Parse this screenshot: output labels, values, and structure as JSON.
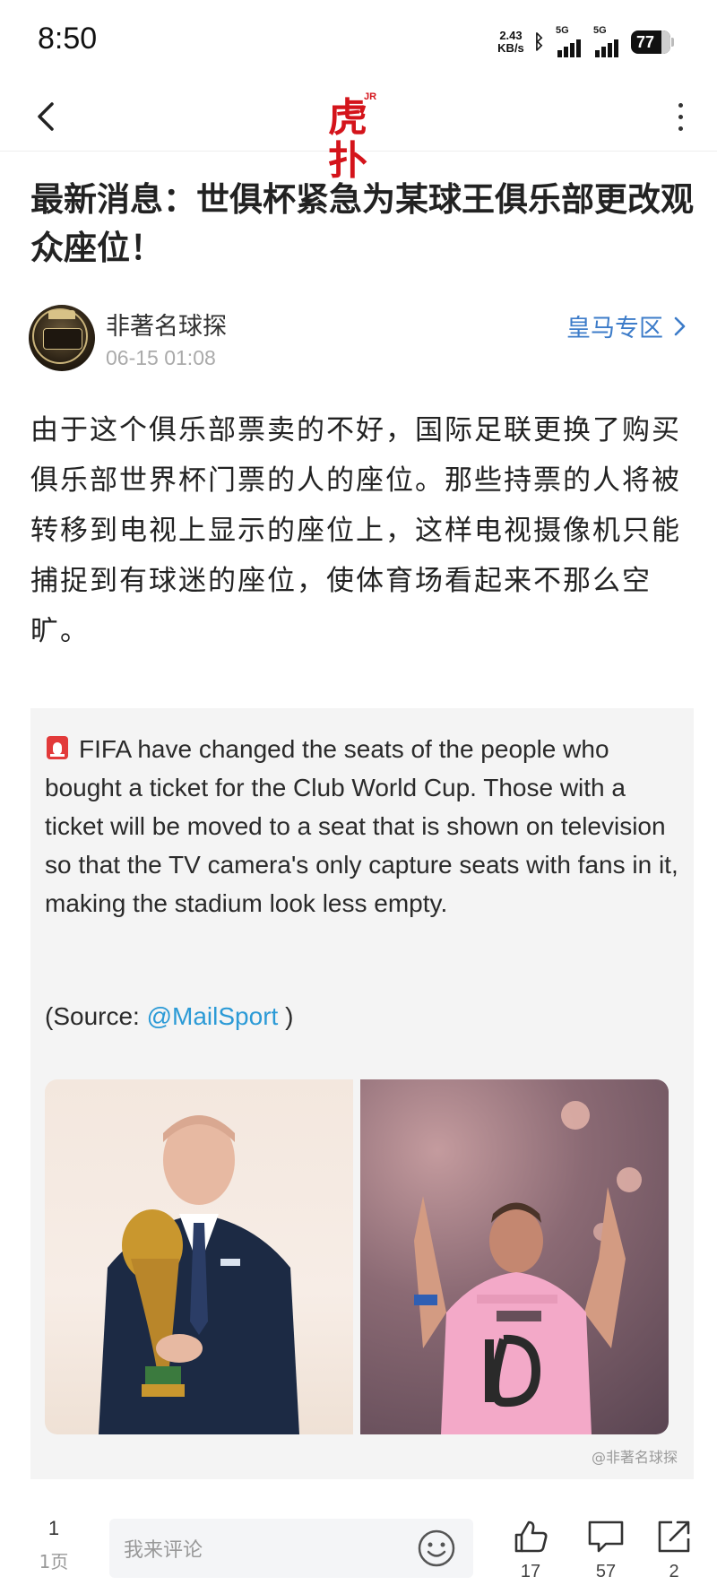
{
  "status_bar": {
    "time": "8:50",
    "net_speed_value": "2.43",
    "net_speed_unit": "KB/s",
    "signal1_tag": "5G",
    "signal2_tag": "5G",
    "battery": "77"
  },
  "header": {
    "logo_tag": "JR",
    "logo_text": "虎扑",
    "back_icon": "chevron-left-icon",
    "more_icon": "more-vertical-icon"
  },
  "article": {
    "title": "最新消息：世俱杯紧急为某球王俱乐部更改观众座位！",
    "author": "非著名球探",
    "time": "06-15 01:08",
    "section_link": "皇马专区",
    "body": "由于这个俱乐部票卖的不好，国际足联更换了购买俱乐部世界杯门票的人的座位。那些持票的人将被转移到电视上显示的座位上，这样电视摄像机只能捕捉到有球迷的座位，使体育场看起来不那么空旷。"
  },
  "tweet": {
    "text": "FIFA have changed the seats of the people who bought a ticket for the Club World Cup. Those with a ticket will be moved to a seat that is shown on television so that the TV camera's only capture seats with fans in it, making the stadium look less empty.",
    "source_prefix": "(Source: ",
    "source_mention": "@MailSport",
    "source_suffix": " )",
    "watermark": "@非著名球探"
  },
  "bottom_bar": {
    "page_current": "1",
    "page_total": "1页",
    "comment_placeholder": "我来评论",
    "likes": "17",
    "comments": "57",
    "shares": "2"
  },
  "colors": {
    "brand": "#d4141b",
    "link": "#3d7cc9",
    "mention": "#2b9ad6"
  }
}
